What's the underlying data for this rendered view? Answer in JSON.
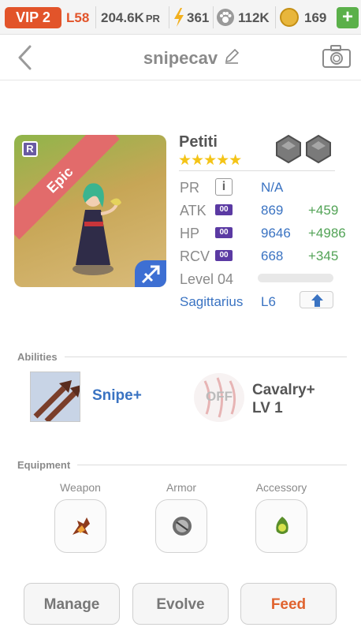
{
  "status_bar": {
    "vip": "VIP 2",
    "level": "L58",
    "pr_value": "204.6K",
    "pr_unit": "PR",
    "energy": "361",
    "food": "112K",
    "gold": "169",
    "add_label": "+"
  },
  "nav": {
    "title": "snipecav",
    "icons": {
      "back": "chevron-left-icon",
      "edit": "pencil-icon",
      "camera": "camera-icon"
    }
  },
  "hero": {
    "rarity_badge": "R",
    "rarity_label": "Epic",
    "name": "Petiti",
    "stars": "★★★★★",
    "star_count": 5,
    "stats": {
      "pr_label": "PR",
      "pr_info": "i",
      "pr_value": "N/A",
      "atk_label": "ATK",
      "atk_pill": "00",
      "atk_value": "869",
      "atk_bonus": "+459",
      "hp_label": "HP",
      "hp_pill": "00",
      "hp_value": "9646",
      "hp_bonus": "+4986",
      "rcv_label": "RCV",
      "rcv_pill": "00",
      "rcv_value": "668",
      "rcv_bonus": "+345"
    },
    "level_text": "Level 04",
    "exp_fraction": 0.0,
    "zodiac": "Sagittarius",
    "zodiac_level": "L6"
  },
  "abilities": {
    "title": "Abilities",
    "items": [
      {
        "name": "Snipe+",
        "state": "on"
      },
      {
        "name": "Cavalry+",
        "level": "LV 1",
        "badge": "OFF"
      }
    ]
  },
  "equipment": {
    "title": "Equipment",
    "slots": [
      {
        "label": "Weapon"
      },
      {
        "label": "Armor"
      },
      {
        "label": "Accessory"
      }
    ]
  },
  "actions": {
    "manage": "Manage",
    "evolve": "Evolve",
    "feed": "Feed"
  },
  "colors": {
    "accent_orange": "#e2542a",
    "link_blue": "#3a73c2",
    "bonus_green": "#52a356",
    "star_gold": "#f4c417",
    "epic_red": "#e26b6b"
  }
}
